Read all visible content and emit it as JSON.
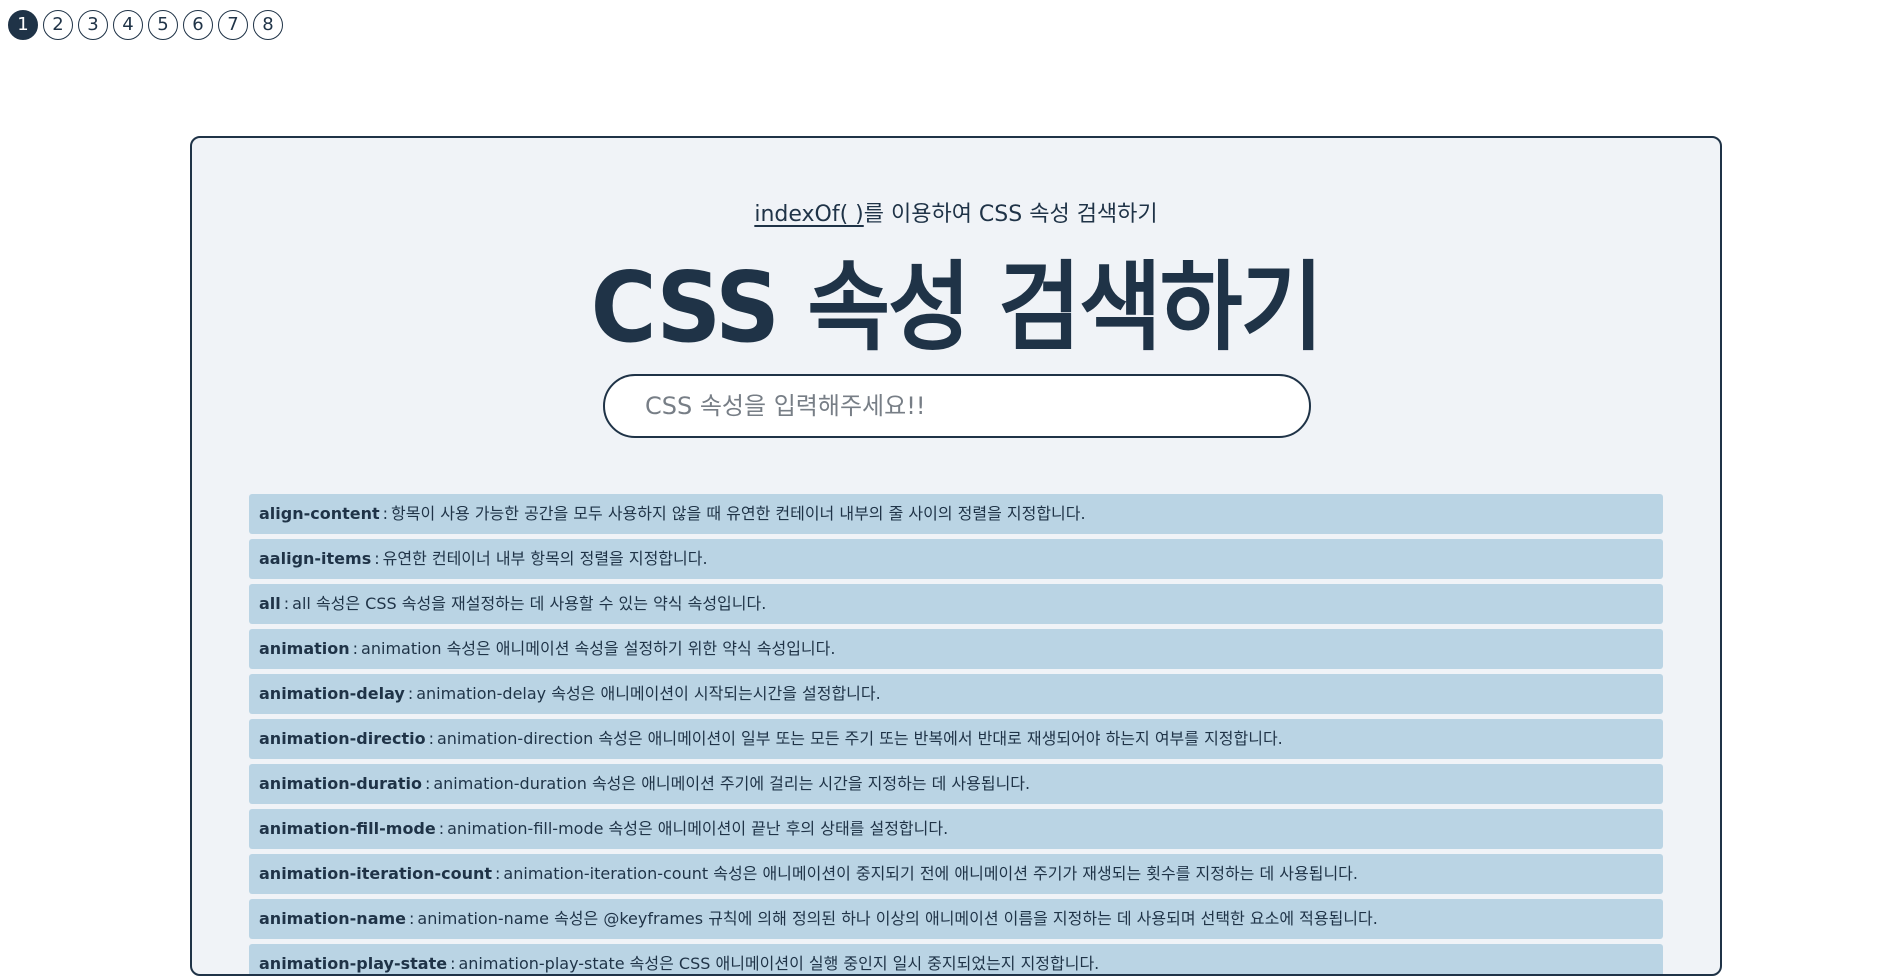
{
  "pagination": {
    "pages": [
      "1",
      "2",
      "3",
      "4",
      "5",
      "6",
      "7",
      "8"
    ],
    "active_index": 0
  },
  "header": {
    "subtitle_code": "indexOf( )",
    "subtitle_rest": "를 이용하여 CSS 속성 검색하기",
    "title": "CSS 속성 검색하기"
  },
  "search": {
    "placeholder": "CSS 속성을 입력해주세요!!",
    "value": ""
  },
  "properties": [
    {
      "name": "align-content",
      "desc": "항목이 사용 가능한 공간을 모두 사용하지 않을 때 유연한 컨테이너 내부의 줄 사이의 정렬을 지정합니다."
    },
    {
      "name": "aalign-items",
      "desc": "유연한 컨테이너 내부 항목의 정렬을 지정합니다."
    },
    {
      "name": "all",
      "desc": "all 속성은 CSS 속성을 재설정하는 데 사용할 수 있는 약식 속성입니다."
    },
    {
      "name": "animation",
      "desc": "animation 속성은 애니메이션 속성을 설정하기 위한 약식 속성입니다."
    },
    {
      "name": "animation-delay",
      "desc": "animation-delay 속성은 애니메이션이 시작되는시간을 설정합니다."
    },
    {
      "name": "animation-directio",
      "desc": "animation-direction 속성은 애니메이션이 일부 또는 모든 주기 또는 반복에서 반대로 재생되어야 하는지 여부를 지정합니다."
    },
    {
      "name": "animation-duratio",
      "desc": "animation-duration 속성은 애니메이션 주기에 걸리는 시간을 지정하는 데 사용됩니다."
    },
    {
      "name": "animation-fill-mode",
      "desc": "animation-fill-mode 속성은 애니메이션이 끝난 후의 상태를 설정합니다."
    },
    {
      "name": "animation-iteration-count",
      "desc": "animation-iteration-count 속성은 애니메이션이 중지되기 전에 애니메이션 주기가 재생되는 횟수를 지정하는 데 사용됩니다."
    },
    {
      "name": "animation-name",
      "desc": "animation-name 속성은 @keyframes 규칙에 의해 정의된 하나 이상의 애니메이션 이름을 지정하는 데 사용되며 선택한 요소에 적용됩니다."
    },
    {
      "name": "animation-play-state",
      "desc": "animation-play-state 속성은 CSS 애니메이션이 실행 중인지 일시 중지되었는지 지정합니다."
    }
  ]
}
